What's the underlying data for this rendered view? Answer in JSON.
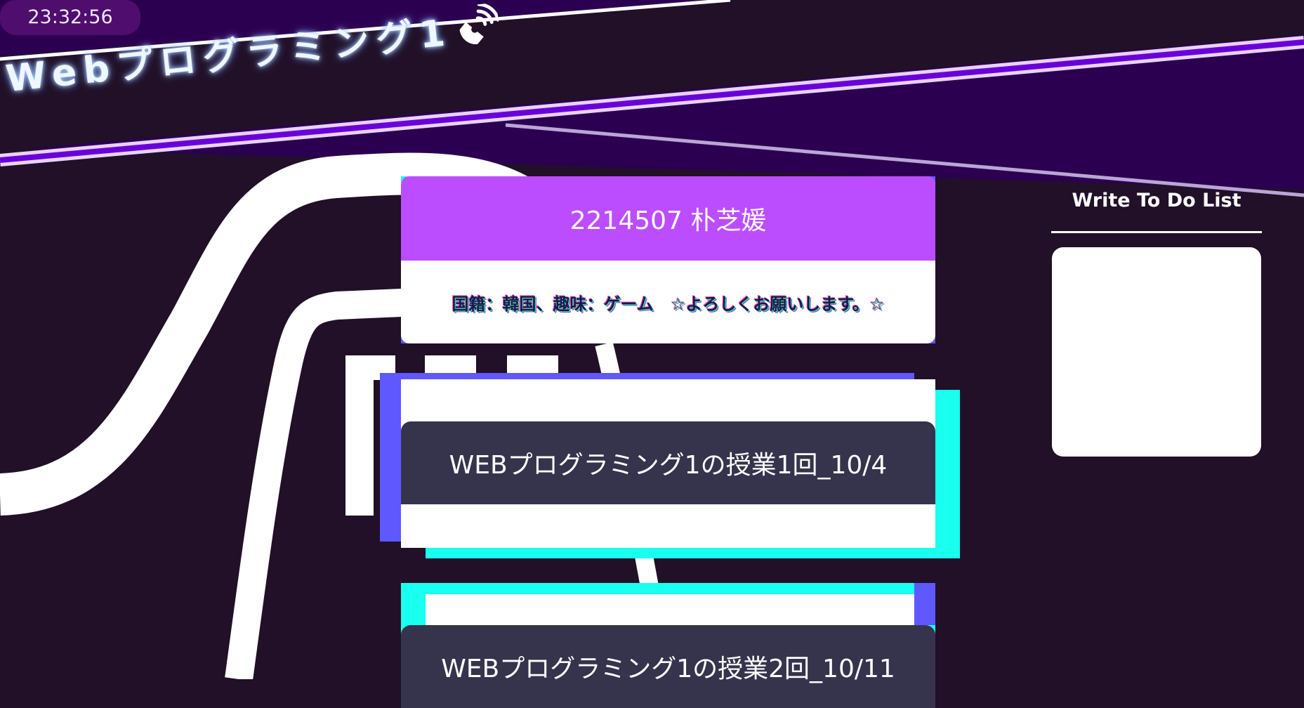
{
  "header": {
    "clock": "23:32:56",
    "site_title": "Webプログラミング1"
  },
  "profile": {
    "name": "2214507 朴芝媛",
    "intro": "国籍：韓国、趣味：ゲーム　☆よろしくお願いします。☆"
  },
  "lessons": [
    {
      "title": "WEBプログラミング1の授業1回_10/4"
    },
    {
      "title": "WEBプログラミング1の授業2回_10/11"
    }
  ],
  "sidebar": {
    "title": "Write To Do List"
  },
  "colors": {
    "background": "#211028",
    "banner_purple": "#2c0050",
    "accent_violet": "#bc4dff",
    "accent_blue": "#5f58ff",
    "accent_cyan": "#19fff0",
    "card_dark": "#36344c"
  },
  "icons": {
    "title_icon": "satellite-dish-icon"
  }
}
